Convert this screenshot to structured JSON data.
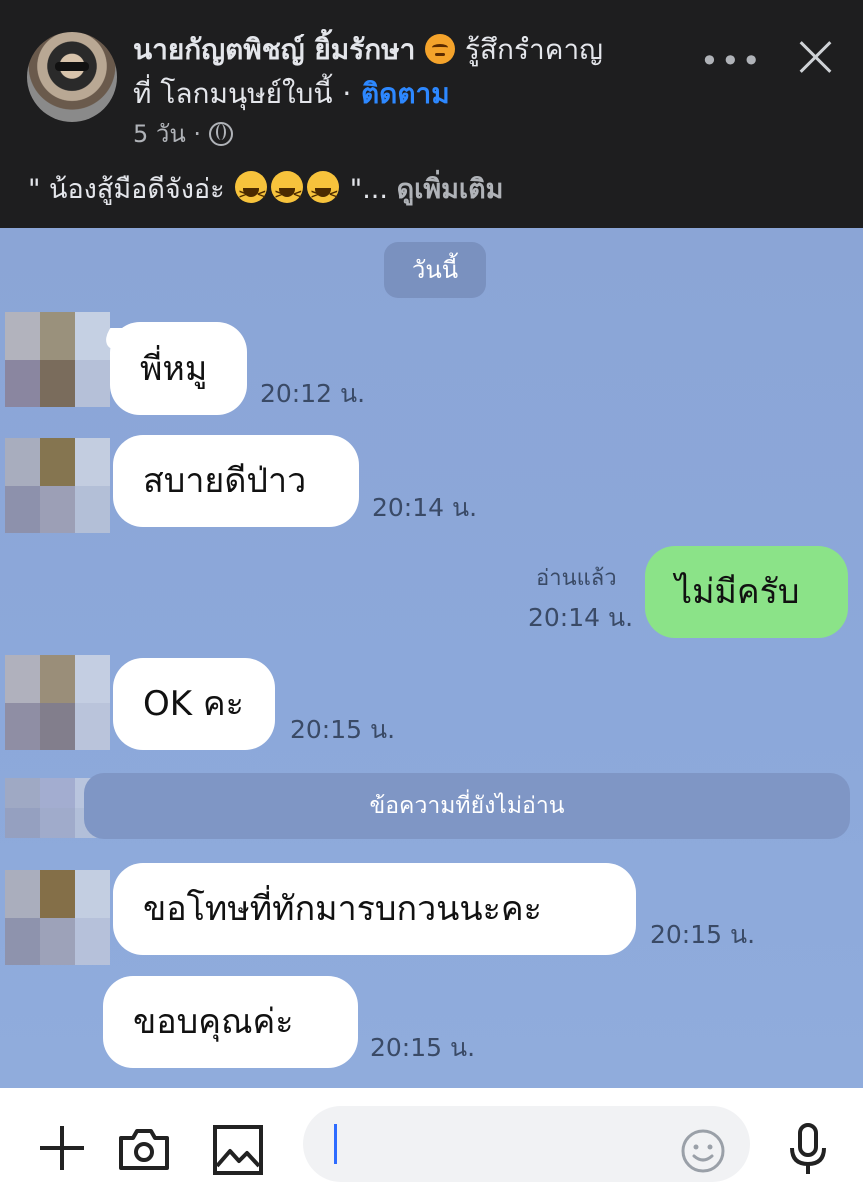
{
  "post": {
    "author": "นายกัญตพิชญ์ ยิ้มรักษา",
    "feeling_prefix": "รู้สึกรำคาญ",
    "feeling_suffix": "ที่ โลกมนุษย์ใบนี้",
    "separator": "·",
    "follow_label": "ติดตาม",
    "time": "5 วัน",
    "time_separator": "·",
    "caption_start": "\" น้องสู้มือดีจังอ่ะ",
    "caption_end": "\"...",
    "see_more": "ดูเพิ่มเติม",
    "icons": [
      "avatar",
      "angry-emoji",
      "laughing-emoji",
      "globe-icon",
      "more-icon",
      "close-icon"
    ]
  },
  "chat": {
    "date_label": "วันนี้",
    "unread_label": "ข้อความที่ยังไม่อ่าน",
    "messages": [
      {
        "side": "incoming",
        "text": "พี่หมู",
        "time": "20:12 น."
      },
      {
        "side": "incoming",
        "text": "สบายดีป่าว",
        "time": "20:14 น."
      },
      {
        "side": "outgoing",
        "text": "ไม่มีครับ",
        "time": "20:14 น.",
        "status": "อ่านแล้ว"
      },
      {
        "side": "incoming",
        "text": "OK คะ",
        "time": "20:15 น."
      },
      {
        "side": "incoming",
        "text": "ขอโทษที่ทักมารบกวนนะคะ",
        "time": "20:15 น."
      },
      {
        "side": "incoming",
        "text": "ขอบคุณค่ะ",
        "time": "20:15 น."
      }
    ]
  },
  "toolbar": {
    "icons": [
      "plus-icon",
      "camera-icon",
      "image-icon",
      "smiley-icon",
      "mic-icon"
    ],
    "input_value": ""
  },
  "colors": {
    "header_bg": "#1e1e1f",
    "chat_bg": "#8ca8da",
    "outgoing_bubble": "#8be388",
    "incoming_bubble": "#ffffff",
    "follow_link": "#2d88ff"
  }
}
